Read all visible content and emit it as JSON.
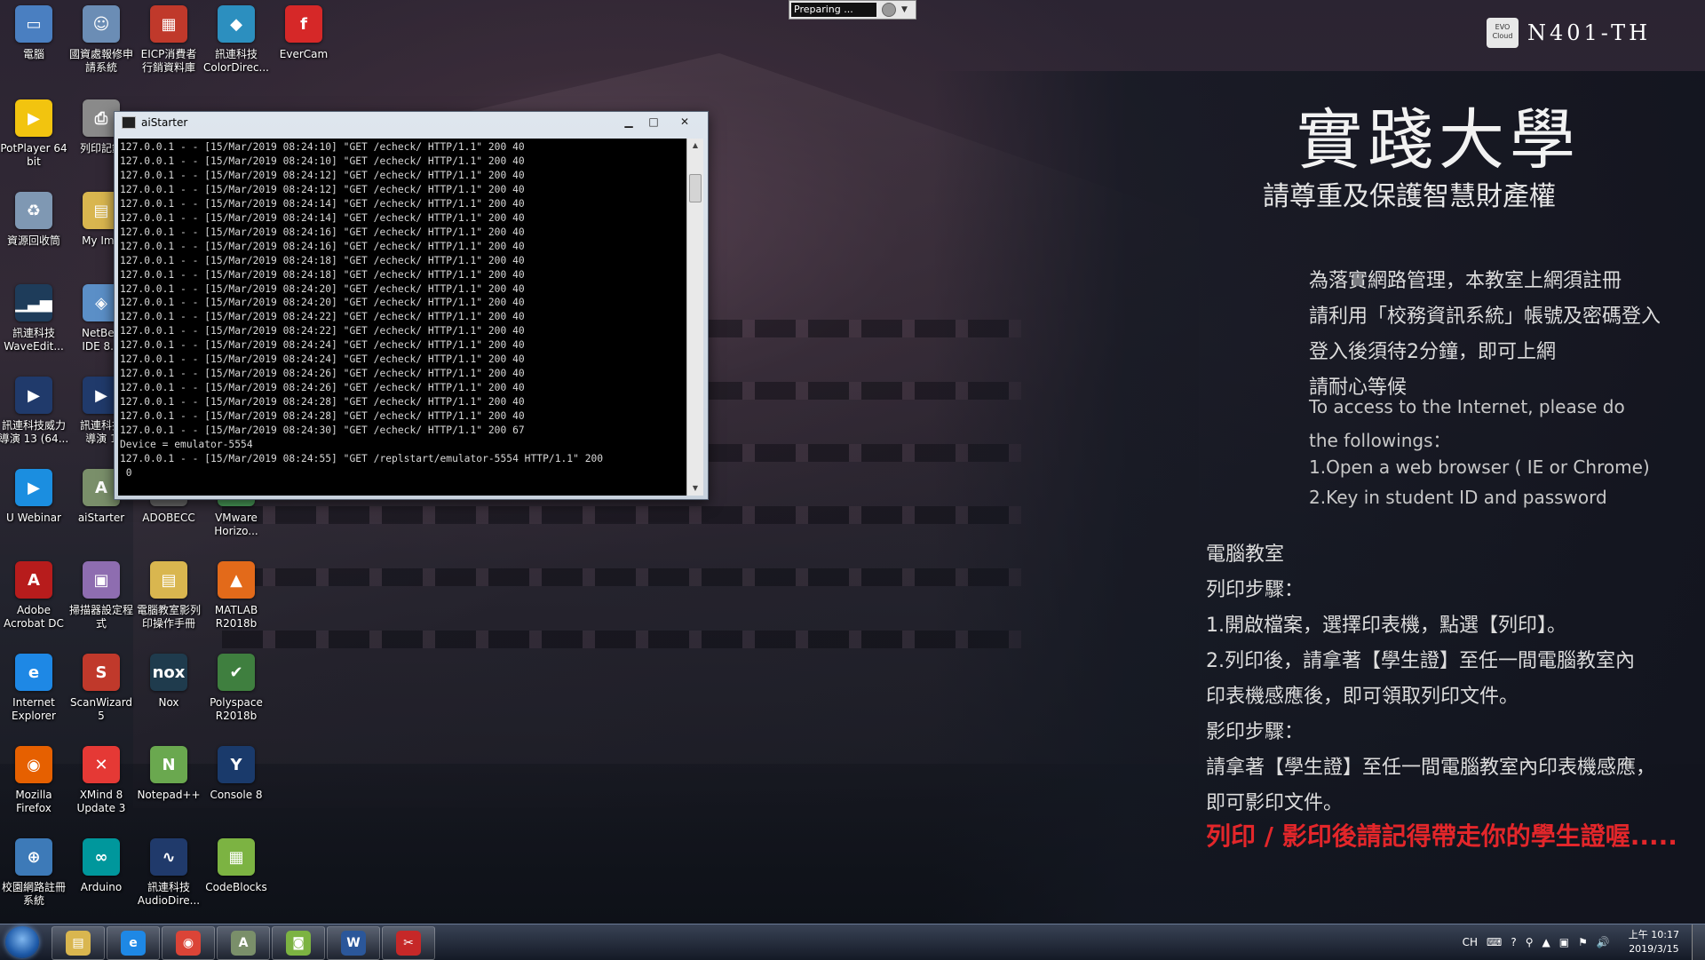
{
  "desktop": {
    "icons": [
      {
        "label": "電腦",
        "icon": "computer-icon",
        "color": "#4a7fc1",
        "glyph": "▭"
      },
      {
        "label": "國資處報修申\n請系統",
        "icon": "users-icon",
        "color": "#6b8db5",
        "glyph": "☺"
      },
      {
        "label": "EICP消費者\n行銷資料庫",
        "icon": "eicp-icon",
        "color": "#c0392b",
        "glyph": "▦"
      },
      {
        "label": "訊連科技\nColorDirec...",
        "icon": "colordirector-icon",
        "color": "#2c8fbf",
        "glyph": "◆"
      },
      {
        "label": "EverCam",
        "icon": "evercam-icon",
        "color": "#d62828",
        "glyph": "f"
      },
      {
        "label": "PotPlayer 64\nbit",
        "icon": "potplayer-icon",
        "color": "#f2c40f",
        "glyph": "▶"
      },
      {
        "label": "列印記錄",
        "icon": "print-icon",
        "color": "#8a8a8a",
        "glyph": "⎙"
      },
      {
        "label": "資源回收筒",
        "icon": "recycle-bin-icon",
        "color": "#7f98b3",
        "glyph": "♻"
      },
      {
        "label": "My Ima",
        "icon": "folder-icon",
        "color": "#d9b64f",
        "glyph": "▤"
      },
      {
        "label": "訊連科技\nWaveEdit...",
        "icon": "waveeditor-icon",
        "color": "#1e3c5a",
        "glyph": "▁▃▅"
      },
      {
        "label": "NetBea\nIDE 8.0",
        "icon": "netbeans-icon",
        "color": "#5b8fc7",
        "glyph": "◈"
      },
      {
        "label": "訊連科技威力\n導演 13 (64...",
        "icon": "powerdirector-icon",
        "color": "#203a6b",
        "glyph": "▶"
      },
      {
        "label": "訊連科技\n導演 1",
        "icon": "powerdirector-icon",
        "color": "#203a6b",
        "glyph": "▶"
      },
      {
        "label": "U Webinar",
        "icon": "uwebinar-icon",
        "color": "#1b8ee0",
        "glyph": "▶"
      },
      {
        "label": "aiStarter",
        "icon": "aistarter-icon",
        "color": "#7a8f6a",
        "glyph": "A"
      },
      {
        "label": "ADOBECC",
        "icon": "adobecc-icon",
        "color": "#6b6b6b",
        "glyph": "A"
      },
      {
        "label": "VMware\nHorizo...",
        "icon": "vmware-icon",
        "color": "#4a9f5a",
        "glyph": "V"
      },
      {
        "label": "Adobe\nAcrobat DC",
        "icon": "acrobat-icon",
        "color": "#b71c1c",
        "glyph": "A"
      },
      {
        "label": "掃描器設定程\n式",
        "icon": "scanner-icon",
        "color": "#8e6db0",
        "glyph": "▣"
      },
      {
        "label": "電腦教室影列\n印操作手冊",
        "icon": "manual-icon",
        "color": "#d9b64f",
        "glyph": "▤"
      },
      {
        "label": "MATLAB\nR2018b",
        "icon": "matlab-icon",
        "color": "#e36a1a",
        "glyph": "▲"
      },
      {
        "label": "Internet\nExplorer",
        "icon": "internet-explorer-icon",
        "color": "#1e88e5",
        "glyph": "e"
      },
      {
        "label": "ScanWizard\n5",
        "icon": "scanwizard-icon",
        "color": "#c0392b",
        "glyph": "S"
      },
      {
        "label": "Nox",
        "icon": "nox-icon",
        "color": "#1f3b4d",
        "glyph": "nox"
      },
      {
        "label": "Polyspace\nR2018b",
        "icon": "polyspace-icon",
        "color": "#3f7f3f",
        "glyph": "✔"
      },
      {
        "label": "Mozilla\nFirefox",
        "icon": "firefox-icon",
        "color": "#e66000",
        "glyph": "◉"
      },
      {
        "label": "XMind 8\nUpdate 3",
        "icon": "xmind-icon",
        "color": "#e53935",
        "glyph": "✕"
      },
      {
        "label": "Notepad++",
        "icon": "notepadpp-icon",
        "color": "#6aa84f",
        "glyph": "N"
      },
      {
        "label": "Console 8",
        "icon": "console-icon",
        "color": "#1a3a6b",
        "glyph": "Y"
      },
      {
        "label": "校園網路註冊\n系統",
        "icon": "network-register-icon",
        "color": "#3d7ab8",
        "glyph": "⊕"
      },
      {
        "label": "Arduino",
        "icon": "arduino-icon",
        "color": "#00979c",
        "glyph": "∞"
      },
      {
        "label": "訊連科技\nAudioDire...",
        "icon": "audiodirector-icon",
        "color": "#203a6b",
        "glyph": "∿"
      },
      {
        "label": "CodeBlocks",
        "icon": "codeblocks-icon",
        "color": "#7cb342",
        "glyph": "▦"
      }
    ]
  },
  "preparing": {
    "text": "Preparing ..."
  },
  "badge": {
    "cloud_text": "EVO Cloud",
    "name": "N401-TH"
  },
  "wallpaper_text": {
    "univ_title": "實踐大學",
    "ip_notice": "請尊重及保護智慧財產權",
    "lines": [
      "為落實網路管理，本教室上網須註冊",
      "請利用「校務資訊系統」帳號及密碼登入",
      "登入後須待2分鐘，即可上網",
      "請耐心等候"
    ],
    "en_lines": [
      "To access to the Internet, please do",
      " the followings：",
      "1.Open a web browser ( IE or Chrome)",
      "2.Key in student ID and password"
    ],
    "lab_lines": [
      "電腦教室",
      "列印步驟：",
      " 1.開啟檔案，選擇印表機，點選【列印】。",
      " 2.列印後，請拿著【學生證】至任一間電腦教室內",
      "    印表機感應後，即可領取列印文件。",
      "影印步驟：",
      "請拿著【學生證】至任一間電腦教室內印表機感應，",
      "即可影印文件。"
    ],
    "warning": "列印 / 影印後請記得帶走你的學生證喔.....",
    "warning_color": "#e3262a"
  },
  "console": {
    "title": "aiStarter",
    "lines": [
      "127.0.0.1 - - [15/Mar/2019 08:24:10] \"GET /echeck/ HTTP/1.1\" 200 40",
      "127.0.0.1 - - [15/Mar/2019 08:24:10] \"GET /echeck/ HTTP/1.1\" 200 40",
      "127.0.0.1 - - [15/Mar/2019 08:24:12] \"GET /echeck/ HTTP/1.1\" 200 40",
      "127.0.0.1 - - [15/Mar/2019 08:24:12] \"GET /echeck/ HTTP/1.1\" 200 40",
      "127.0.0.1 - - [15/Mar/2019 08:24:14] \"GET /echeck/ HTTP/1.1\" 200 40",
      "127.0.0.1 - - [15/Mar/2019 08:24:14] \"GET /echeck/ HTTP/1.1\" 200 40",
      "127.0.0.1 - - [15/Mar/2019 08:24:16] \"GET /echeck/ HTTP/1.1\" 200 40",
      "127.0.0.1 - - [15/Mar/2019 08:24:16] \"GET /echeck/ HTTP/1.1\" 200 40",
      "127.0.0.1 - - [15/Mar/2019 08:24:18] \"GET /echeck/ HTTP/1.1\" 200 40",
      "127.0.0.1 - - [15/Mar/2019 08:24:18] \"GET /echeck/ HTTP/1.1\" 200 40",
      "127.0.0.1 - - [15/Mar/2019 08:24:20] \"GET /echeck/ HTTP/1.1\" 200 40",
      "127.0.0.1 - - [15/Mar/2019 08:24:20] \"GET /echeck/ HTTP/1.1\" 200 40",
      "127.0.0.1 - - [15/Mar/2019 08:24:22] \"GET /echeck/ HTTP/1.1\" 200 40",
      "127.0.0.1 - - [15/Mar/2019 08:24:22] \"GET /echeck/ HTTP/1.1\" 200 40",
      "127.0.0.1 - - [15/Mar/2019 08:24:24] \"GET /echeck/ HTTP/1.1\" 200 40",
      "127.0.0.1 - - [15/Mar/2019 08:24:24] \"GET /echeck/ HTTP/1.1\" 200 40",
      "127.0.0.1 - - [15/Mar/2019 08:24:26] \"GET /echeck/ HTTP/1.1\" 200 40",
      "127.0.0.1 - - [15/Mar/2019 08:24:26] \"GET /echeck/ HTTP/1.1\" 200 40",
      "127.0.0.1 - - [15/Mar/2019 08:24:28] \"GET /echeck/ HTTP/1.1\" 200 40",
      "127.0.0.1 - - [15/Mar/2019 08:24:28] \"GET /echeck/ HTTP/1.1\" 200 40",
      "127.0.0.1 - - [15/Mar/2019 08:24:30] \"GET /echeck/ HTTP/1.1\" 200 67",
      "Device = emulator-5554",
      "127.0.0.1 - - [15/Mar/2019 08:24:55] \"GET /replstart/emulator-5554 HTTP/1.1\" 200",
      " 0"
    ]
  },
  "taskbar": {
    "items": [
      {
        "name": "explorer",
        "icon": "file-explorer-icon",
        "color": "#d9b64f",
        "glyph": "▤"
      },
      {
        "name": "ie",
        "icon": "internet-explorer-icon",
        "color": "#1e88e5",
        "glyph": "e"
      },
      {
        "name": "chrome",
        "icon": "chrome-icon",
        "color": "#db4437",
        "glyph": "◉"
      },
      {
        "name": "aistarter",
        "icon": "aistarter-icon",
        "color": "#7a8f6a",
        "glyph": "A"
      },
      {
        "name": "android",
        "icon": "android-icon",
        "color": "#7cb342",
        "glyph": "◙"
      },
      {
        "name": "word",
        "icon": "word-icon",
        "color": "#2b579a",
        "glyph": "W"
      },
      {
        "name": "snipping",
        "icon": "snipping-tool-icon",
        "color": "#c62828",
        "glyph": "✂"
      }
    ],
    "tray": {
      "lang": "CH",
      "time": "上午 10:17",
      "date": "2019/3/15"
    }
  }
}
